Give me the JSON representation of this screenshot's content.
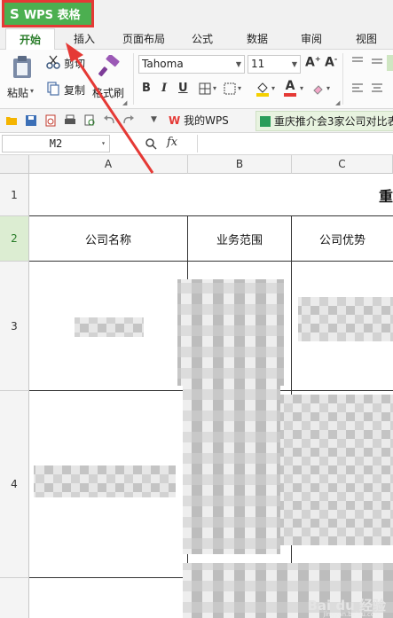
{
  "app": {
    "logo_glyph": "S",
    "name": "WPS 表格",
    "accent_color": "#4caf50",
    "highlight_border_color": "#e53935"
  },
  "tabs": [
    {
      "label": "开始",
      "active": true
    },
    {
      "label": "插入",
      "active": false
    },
    {
      "label": "页面布局",
      "active": false
    },
    {
      "label": "公式",
      "active": false
    },
    {
      "label": "数据",
      "active": false
    },
    {
      "label": "审阅",
      "active": false
    },
    {
      "label": "视图",
      "active": false
    }
  ],
  "ribbon": {
    "paste_label": "粘贴",
    "cut_label": "剪切",
    "copy_label": "复制",
    "format_painter_label": "格式刷",
    "font_name": "Tahoma",
    "font_size": "11",
    "bold": "B",
    "italic": "I",
    "underline": "U",
    "font_color": "#e53935",
    "fill_color": "#f5d000"
  },
  "quickbar": {
    "home_tab_label": "我的WPS",
    "doc_tab_label": "重庆推介会3家公司对比表"
  },
  "formula_bar": {
    "name_box": "M2",
    "fx_label": "fx",
    "search_glyph": "🔍"
  },
  "sheet": {
    "columns": [
      "A",
      "B",
      "C"
    ],
    "rows": [
      "1",
      "2",
      "3",
      "4"
    ],
    "selected_row": "2",
    "title_cell_fragment": "重",
    "headers": [
      "公司名称",
      "业务范围",
      "公司优势"
    ]
  },
  "watermark": {
    "text": "Bai du 经验",
    "sub": "jingyan.baidu.com"
  }
}
